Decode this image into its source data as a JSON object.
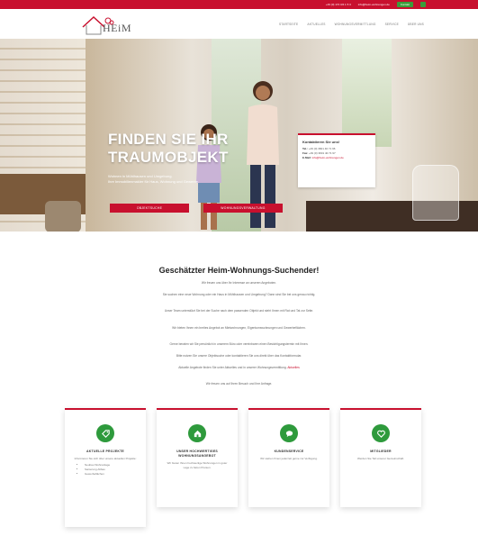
{
  "topbar": {
    "phone": "+49 (0) 174 3/4 1 5 3",
    "email": "info@heim-wohnungen.de",
    "cta": "Kontakt",
    "colors": {
      "bar": "#c8102e",
      "cta": "#3a9d3a"
    }
  },
  "header": {
    "logo_text": "HEiM",
    "nav": [
      "STARTSEITE",
      "AKTUELLES",
      "WOHNUNGSVERMITTLUNG",
      "SERVICE",
      "ÜBER UNS"
    ]
  },
  "hero": {
    "headline_line1": "FINDEN SIE IHR",
    "headline_line2": "TRAUMOBJEKT",
    "subtext_line1": "Wohnen in Mühlhausen und Umgebung.",
    "subtext_line2": "Ihre Immobilienmakler für Haus, Wohnung und Gewerbe.",
    "button_primary": "OBJEKTSUCHE",
    "button_secondary": "WOHNUNGSVERWALTUNG",
    "contact": {
      "title": "Kontaktieren Sie uns!",
      "tel_label": "Tel.:",
      "tel": "+49 (0) 3601 40 71 96",
      "fax_label": "Fax:",
      "fax": "+49 (0) 3601 40 71 97",
      "email_label": "E-Mail:",
      "email": "info@heim-wohnungen.de"
    }
  },
  "intro": {
    "title": "Geschätzter Heim-Wohnungs-Suchender!",
    "paragraphs": [
      "Wir freuen uns über Ihr Interesse an unseren Angeboten.",
      "Sie suchen eine neue Wohnung oder ein Haus in Mühlhausen und Umgebung? Dann sind Sie bei uns genau richtig.",
      "Unser Team unterstützt Sie bei der Suche nach dem passenden Objekt und steht Ihnen mit Rat und Tat zur Seite.",
      "Wir bieten Ihnen ein breites Angebot an Mietwohnungen, Eigentumswohnungen und Gewerbeflächen.",
      "Gerne beraten wir Sie persönlich in unserem Büro oder vereinbaren einen Besichtigungstermin mit Ihnen.",
      "Bitte nutzen Sie unsere Objektsuche oder kontaktieren Sie uns direkt über das Kontaktformular.",
      "Aktuelle Angebote finden Sie unter Aktuelles und in unserer Wohnungsvermittlung.",
      "Wir freuen uns auf Ihren Besuch und Ihre Anfrage."
    ],
    "highlights": [
      "Kontaktformular",
      "Aktuelles",
      "Wohnungsvermittlung"
    ]
  },
  "cards": [
    {
      "title": "AKTUELLE PROJEKTE",
      "text": "Informieren Sie sich über unsere aktuellen Projekte:",
      "items": [
        "Neubau Wohnanlage",
        "Sanierung Altbau",
        "Gewerbeflächen"
      ],
      "icon": "tag-icon"
    },
    {
      "title": "UNSER HOCHWERTIGES WOHNUNGSANGEBOT",
      "text": "Wir bieten Ihnen hochwertige Wohnungen in guter Lage zu fairen Preisen.",
      "items": [],
      "icon": "home-icon"
    },
    {
      "title": "KUNDENSERVICE",
      "text": "Wir stehen Ihnen jederzeit gerne zur Verfügung.",
      "items": [],
      "icon": "chat-icon"
    },
    {
      "title": "MITGLIEDER",
      "text": "Werden Sie Teil unserer Gemeinschaft.",
      "items": [],
      "icon": "heart-icon"
    }
  ]
}
